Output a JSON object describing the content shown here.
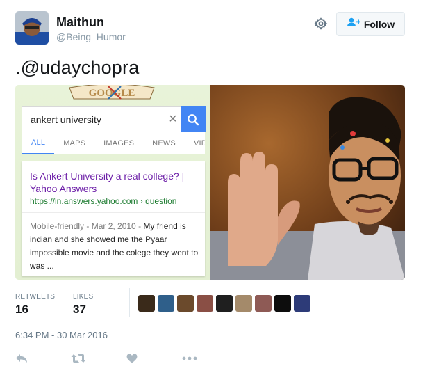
{
  "user": {
    "name": "Maithun",
    "handle": "@Being_Humor"
  },
  "follow_button": {
    "label": "Follow"
  },
  "tweet": {
    "text": ".@udaychopra"
  },
  "media": {
    "search": {
      "doodle_text": "GOOGLE",
      "query": "ankert university"
    },
    "tabs": [
      "ALL",
      "MAPS",
      "IMAGES",
      "NEWS",
      "VID"
    ],
    "result": {
      "title": "Is Ankert University a real college? | Yahoo Answers",
      "url": "https://in.answers.yahoo.com › question",
      "snippet_meta": "Mobile-friendly - Mar 2, 2010 - ",
      "snippet": "My friend is indian and she showed me the Pyaar impossible movie and the colege they went to was ..."
    }
  },
  "stats": {
    "retweets_label": "RETWEETS",
    "retweets_value": "16",
    "likes_label": "LIKES",
    "likes_value": "37"
  },
  "likers": [
    {
      "name": "liker-avatar",
      "color": "#3a2a1a"
    },
    {
      "name": "liker-avatar",
      "color": "#2f5f8a"
    },
    {
      "name": "liker-avatar",
      "color": "#6b4a2c"
    },
    {
      "name": "liker-avatar",
      "color": "#8a4f45"
    },
    {
      "name": "liker-avatar",
      "color": "#1f1f1f"
    },
    {
      "name": "liker-avatar",
      "color": "#a48a6a"
    },
    {
      "name": "liker-avatar",
      "color": "#8e5a55"
    },
    {
      "name": "liker-avatar",
      "color": "#0d0d0d"
    },
    {
      "name": "liker-avatar",
      "color": "#2d3b78"
    }
  ],
  "timestamp": "6:34 PM - 30 Mar 2016",
  "actions": [
    "reply-icon",
    "retweet-icon",
    "like-icon",
    "more-icon"
  ],
  "colors": {
    "accent": "#1da1f2",
    "google_blue": "#4285f4",
    "result_title": "#6d1fa8",
    "result_url": "#1a7a2e"
  }
}
